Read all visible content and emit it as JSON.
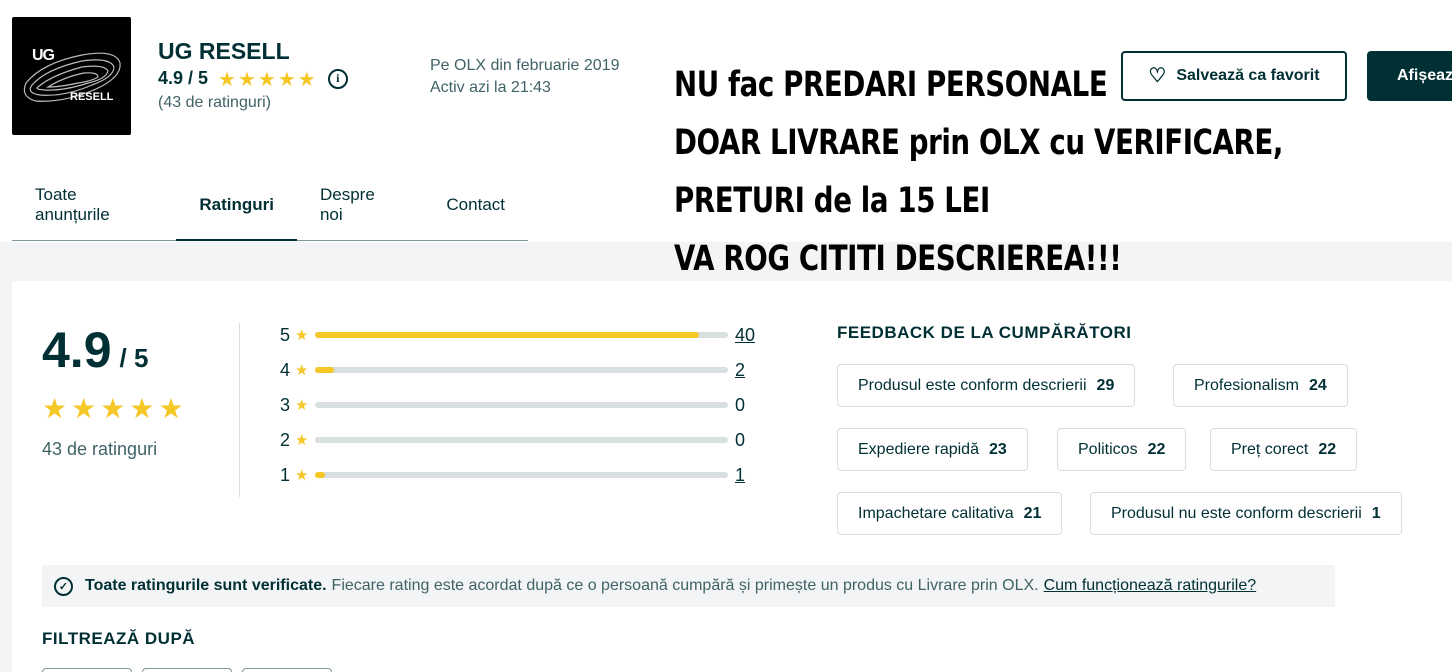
{
  "shop": {
    "logo_text_top": "UG",
    "logo_text_bottom": "RESELL",
    "name": "UG RESELL",
    "rating": "4.9 / 5",
    "rating_count": "(43 de ratinguri)",
    "since": "Pe OLX din februarie 2019",
    "active": "Activ azi la 21:43"
  },
  "banner": {
    "line1": "NU fac PREDARI PERSONALE",
    "line2": "DOAR LIVRARE prin OLX cu VERIFICARE,",
    "line3": "PRETURI de la 15 LEI",
    "line4": "VA ROG CITITI DESCRIEREA!!!"
  },
  "actions": {
    "favorite_label": "Salvează ca favorit",
    "show_label": "Afișează"
  },
  "tabs": [
    {
      "label": "Toate anunțurile"
    },
    {
      "label": "Ratinguri"
    },
    {
      "label": "Despre noi"
    },
    {
      "label": "Contact"
    }
  ],
  "ratings": {
    "score": "4.9",
    "out_of": "/ 5",
    "count_label": "43 de ratinguri",
    "stars_filled": 5,
    "distribution": [
      {
        "stars": "5",
        "count": "40",
        "value": 40,
        "linked": true
      },
      {
        "stars": "4",
        "count": "2",
        "value": 2,
        "linked": true
      },
      {
        "stars": "3",
        "count": "0",
        "value": 0,
        "linked": false
      },
      {
        "stars": "2",
        "count": "0",
        "value": 0,
        "linked": false
      },
      {
        "stars": "1",
        "count": "1",
        "value": 1,
        "linked": true
      }
    ],
    "total": 43
  },
  "feedback": {
    "title": "FEEDBACK DE LA CUMPĂRĂTORI",
    "chips": [
      {
        "label": "Produsul este conform descrierii",
        "count": "29"
      },
      {
        "label": "Profesionalism",
        "count": "24"
      },
      {
        "label": "Expediere rapidă",
        "count": "23"
      },
      {
        "label": "Politicos",
        "count": "22"
      },
      {
        "label": "Preț corect",
        "count": "22"
      },
      {
        "label": "Impachetare calitativa",
        "count": "21"
      },
      {
        "label": "Produsul nu este conform descrierii",
        "count": "1"
      }
    ]
  },
  "verified": {
    "bold": "Toate ratingurile sunt verificate.",
    "text": "Fiecare rating este acordat după ce o persoană cumpără și primește un produs cu Livrare prin OLX.",
    "link": "Cum funcționează ratingurile?"
  },
  "filter": {
    "title": "FILTREAZĂ DUPĂ"
  },
  "colors": {
    "primary": "#002f34",
    "star": "#f5c727",
    "muted": "#406367",
    "track": "#d8dfe0"
  }
}
